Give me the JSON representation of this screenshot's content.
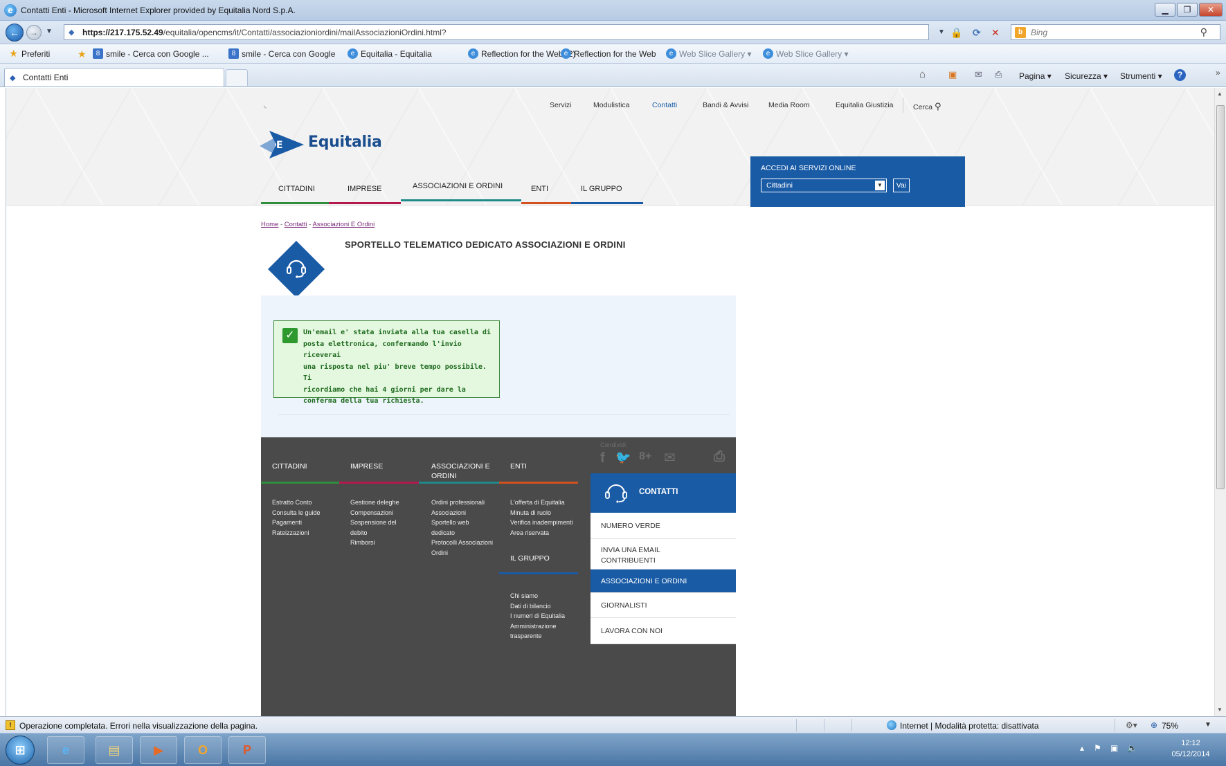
{
  "window": {
    "title": "Contatti Enti - Microsoft Internet Explorer provided by Equitalia Nord S.p.A."
  },
  "address": {
    "url_host": "https://217.175.52.49",
    "url_path": "/equitalia/opencms/it/Contatti/associazioniordini/mailAssociazioniOrdini.html?",
    "search_placeholder": "Bing"
  },
  "favorites": {
    "preferiti": "Preferiti",
    "items": [
      "smile - Cerca con Google ...",
      "smile - Cerca con Google",
      "Equitalia - Equitalia",
      "Reflection for the Web (2)",
      "Reflection for the Web",
      "Web Slice Gallery ▾",
      "Web Slice Gallery ▾"
    ]
  },
  "tab": {
    "label": "Contatti Enti"
  },
  "commandbar": {
    "pagina": "Pagina ▾",
    "sicurezza": "Sicurezza ▾",
    "strumenti": "Strumenti ▾"
  },
  "site": {
    "utility_nav": [
      "Servizi",
      "Modulistica",
      "Contatti",
      "Bandi & Avvisi",
      "Media Room",
      "Equitalia Giustizia"
    ],
    "search_label": "Cerca",
    "logo_text": "Equitalia",
    "main_nav": [
      "CITTADINI",
      "IMPRESE",
      "ASSOCIAZIONI E ORDINI",
      "ENTI",
      "IL GRUPPO"
    ],
    "login": {
      "label": "ACCEDI AI SERVIZI ONLINE",
      "selected": "Cittadini",
      "button": "Vai"
    },
    "breadcrumb": [
      "Home",
      "Contatti",
      "Associazioni E Ordini"
    ],
    "breadcrumb_sep": "-",
    "page_title": "SPORTELLO TELEMATICO DEDICATO ASSOCIAZIONI E ORDINI",
    "success_lines": [
      "Un'email e' stata inviata alla tua casella di",
      "posta elettronica, confermando l'invio riceverai",
      "una risposta nel piu' breve tempo possibile. Ti",
      "ricordiamo che hai 4 giorni per dare la",
      "conferma della tua richiesta."
    ],
    "footer": {
      "condividi": "Condividi",
      "columns": [
        {
          "heading": "CITTADINI",
          "links": [
            "Estratto Conto",
            "Consulta le guide",
            "Pagamenti",
            "Rateizzazioni"
          ]
        },
        {
          "heading": "IMPRESE",
          "links": [
            "Gestione deleghe",
            "Compensazioni",
            "Sospensione del",
            "debito",
            "Rimborsi"
          ]
        },
        {
          "heading": "ASSOCIAZIONI E",
          "heading2": "ORDINI",
          "links": [
            "Ordini professionali",
            "Associazioni",
            "Sportello web",
            "dedicato",
            "Protocolli Associazioni",
            "Ordini"
          ]
        },
        {
          "heading": "ENTI",
          "links": [
            "L'offerta di Equitalia",
            "Minuta di ruolo",
            "Verifica inadempimenti",
            "Area riservata"
          ]
        }
      ],
      "gruppo": {
        "heading": "IL GRUPPO",
        "links": [
          "Chi siamo",
          "Dati di bilancio",
          "I numeri di Equitalia",
          "Amministrazione",
          "trasparente"
        ]
      },
      "contatti_title": "CONTATTI",
      "contatti_menu": [
        "NUMERO VERDE",
        "INVIA UNA EMAIL",
        "CONTRIBUENTI",
        "ASSOCIAZIONI E ORDINI",
        "GIORNALISTI",
        "LAVORA CON NOI"
      ]
    }
  },
  "status": {
    "message": "Operazione completata. Errori nella visualizzazione della pagina.",
    "zone": "Internet | Modalità protetta: disattivata",
    "zoom": "75%"
  },
  "taskbar": {
    "time": "12:12",
    "date": "05/12/2014"
  },
  "colors": {
    "brand_blue": "#1a5ba6",
    "cittadini": "#2f8f3c",
    "imprese": "#b3184f",
    "associazioni": "#1f8a8a",
    "enti": "#d4501e",
    "gruppo": "#1a5ba6",
    "success_green": "#2e9a2e"
  }
}
